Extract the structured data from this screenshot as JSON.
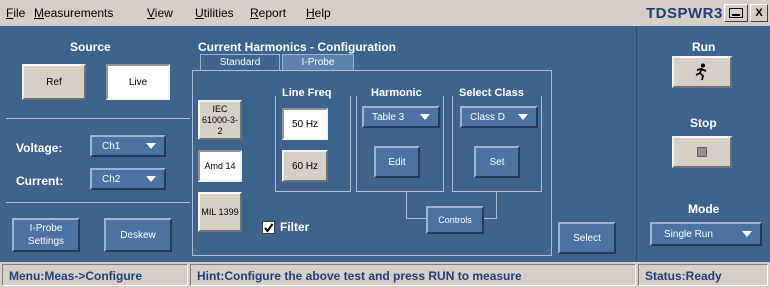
{
  "menu": {
    "items": [
      "File",
      "Measurements",
      "View",
      "Utilities",
      "Report",
      "Help"
    ]
  },
  "app_title": "TDSPWR3",
  "window_controls": {
    "minimize": "",
    "close": "X"
  },
  "source": {
    "title": "Source",
    "ref_label": "Ref",
    "live_label": "Live",
    "voltage_label": "Voltage:",
    "voltage_value": "Ch1",
    "current_label": "Current:",
    "current_value": "Ch2",
    "iprobe_settings_label": "I-Probe Settings",
    "deskew_label": "Deskew"
  },
  "config": {
    "title": "Current Harmonics - Configuration",
    "tabs": [
      {
        "label": "Standard",
        "active": false
      },
      {
        "label": "I-Probe",
        "active": true
      }
    ],
    "standards": [
      "IEC 61000-3-2",
      "Amd 14",
      "MIL 1399"
    ],
    "line_freq": {
      "title": "Line Freq",
      "options": [
        "50 Hz",
        "60 Hz"
      ],
      "selected": "50 Hz"
    },
    "harmonic": {
      "title": "Harmonic",
      "value": "Table 3",
      "edit_label": "Edit"
    },
    "select_class": {
      "title": "Select Class",
      "value": "Class D",
      "set_label": "Set"
    },
    "filter": {
      "label": "Filter",
      "checked": true
    },
    "controls_label": "Controls",
    "select_label": "Select"
  },
  "run_panel": {
    "run_title": "Run",
    "stop_title": "Stop",
    "mode_title": "Mode",
    "mode_value": "Single Run"
  },
  "status": {
    "menu": "Menu:Meas->Configure",
    "hint": "Hint:Configure the above test and press RUN to measure",
    "state": "Status:Ready"
  },
  "colors": {
    "panel_blue": "#3e648e",
    "button_blue": "#4b72a0",
    "chrome_gray": "#d4d0c8",
    "title_blue": "#1f3f7a"
  }
}
